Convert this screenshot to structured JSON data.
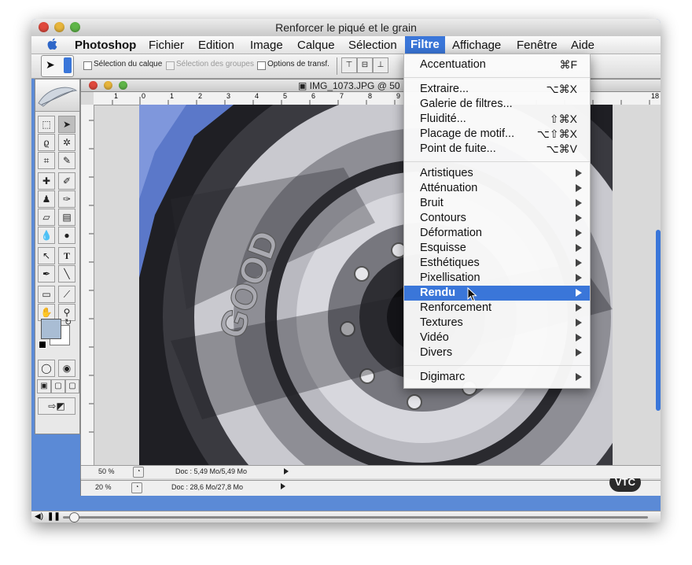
{
  "window": {
    "title": "Renforcer le piqué et le grain"
  },
  "menubar": {
    "app": "Photoshop",
    "items": [
      "Fichier",
      "Edition",
      "Image",
      "Calque",
      "Sélection",
      "Filtre",
      "Affichage",
      "Fenêtre",
      "Aide"
    ],
    "active": "Filtre"
  },
  "options": {
    "selection_calque": "Sélection du calque",
    "selection_groupes": "Sélection des groupes",
    "options_transf": "Options de transf."
  },
  "document": {
    "tab_title": "IMG_1073.JPG @ 50",
    "zoom_front": "50 %",
    "doc_front": "Doc : 5,49 Mo/5,49 Mo",
    "zoom_back": "20 %",
    "doc_back": "Doc : 28,6 Mo/27,8 Mo",
    "ruler_labels": [
      "1",
      "0",
      "1",
      "2",
      "3",
      "4",
      "5",
      "6",
      "7",
      "8",
      "9",
      "10",
      "11",
      "12",
      "13",
      "14",
      "15",
      "16",
      "17",
      "18"
    ]
  },
  "filter_menu": {
    "group1": [
      {
        "label": "Accentuation",
        "shortcut": "⌘F"
      }
    ],
    "group2": [
      {
        "label": "Extraire...",
        "shortcut": "⌥⌘X"
      },
      {
        "label": "Galerie de filtres...",
        "shortcut": ""
      },
      {
        "label": "Fluidité...",
        "shortcut": "⇧⌘X"
      },
      {
        "label": "Placage de motif...",
        "shortcut": "⌥⇧⌘X"
      },
      {
        "label": "Point de fuite...",
        "shortcut": "⌥⌘V"
      }
    ],
    "group3": [
      "Artistiques",
      "Atténuation",
      "Bruit",
      "Contours",
      "Déformation",
      "Esquisse",
      "Esthétiques",
      "Pixellisation",
      "Rendu",
      "Renforcement",
      "Textures",
      "Vidéo",
      "Divers"
    ],
    "highlighted": "Rendu",
    "group4": [
      "Digimarc"
    ]
  },
  "watermark": "VTC",
  "colors": {
    "menu_highlight": "#3a76d9",
    "desktop_blue": "#5b8ad6"
  }
}
